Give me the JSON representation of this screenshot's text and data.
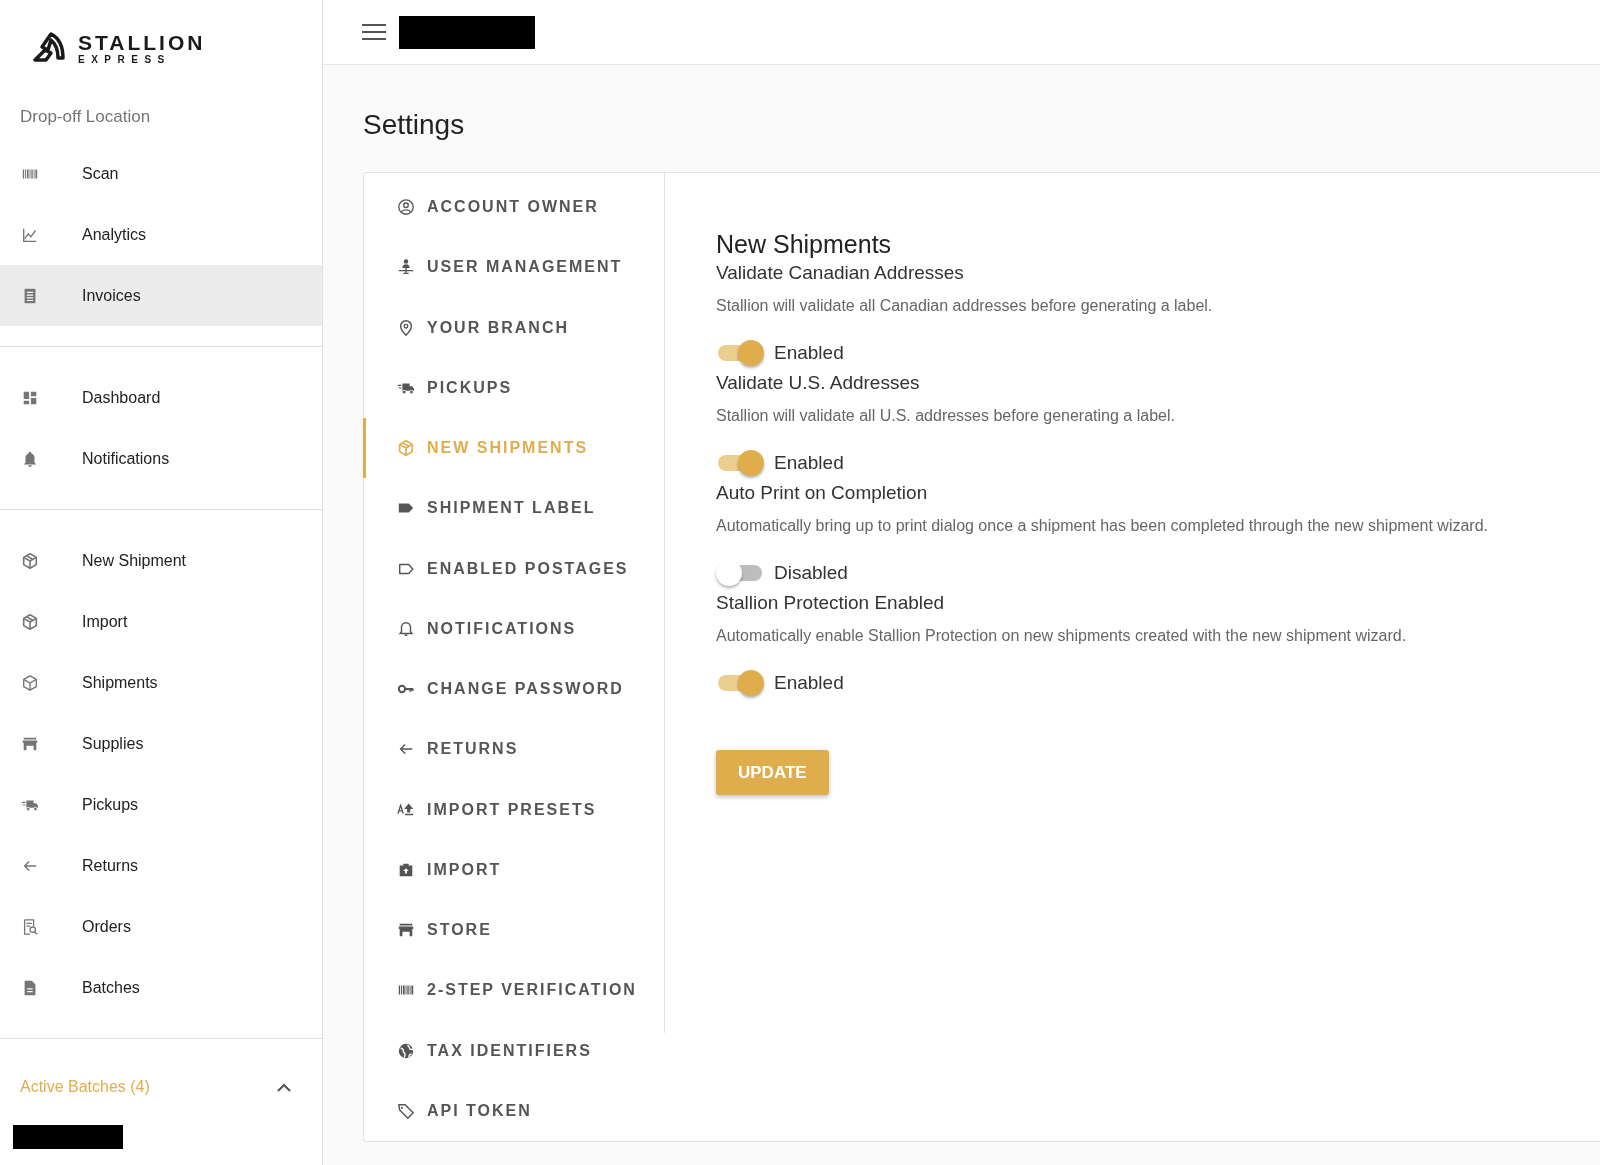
{
  "logo": {
    "name": "STALLION",
    "tagline": "EXPRESS"
  },
  "sidebar": {
    "location_label": "Drop-off Location",
    "sections": [
      {
        "items": [
          {
            "label": "Scan",
            "selected": false
          },
          {
            "label": "Analytics",
            "selected": false
          },
          {
            "label": "Invoices",
            "selected": true
          }
        ]
      },
      {
        "items": [
          {
            "label": "Dashboard",
            "selected": false
          },
          {
            "label": "Notifications",
            "selected": false
          }
        ]
      },
      {
        "items": [
          {
            "label": "New Shipment",
            "selected": false
          },
          {
            "label": "Import",
            "selected": false
          },
          {
            "label": "Shipments",
            "selected": false
          },
          {
            "label": "Supplies",
            "selected": false
          },
          {
            "label": "Pickups",
            "selected": false
          },
          {
            "label": "Returns",
            "selected": false
          },
          {
            "label": "Orders",
            "selected": false
          },
          {
            "label": "Batches",
            "selected": false
          }
        ]
      }
    ],
    "active_batches": {
      "label": "Active Batches (4)",
      "expanded": true
    }
  },
  "page_title": "Settings",
  "settings_nav": [
    {
      "label": "ACCOUNT OWNER",
      "selected": false
    },
    {
      "label": "USER MANAGEMENT",
      "selected": false
    },
    {
      "label": "YOUR BRANCH",
      "selected": false
    },
    {
      "label": "PICKUPS",
      "selected": false
    },
    {
      "label": "NEW SHIPMENTS",
      "selected": true
    },
    {
      "label": "SHIPMENT LABEL",
      "selected": false
    },
    {
      "label": "ENABLED POSTAGES",
      "selected": false
    },
    {
      "label": "NOTIFICATIONS",
      "selected": false
    },
    {
      "label": "CHANGE PASSWORD",
      "selected": false
    },
    {
      "label": "RETURNS",
      "selected": false
    },
    {
      "label": "IMPORT PRESETS",
      "selected": false
    },
    {
      "label": "IMPORT",
      "selected": false
    },
    {
      "label": "STORE",
      "selected": false
    },
    {
      "label": "2-STEP VERIFICATION",
      "selected": false
    },
    {
      "label": "TAX IDENTIFIERS",
      "selected": false
    },
    {
      "label": "API TOKEN",
      "selected": false
    }
  ],
  "panel": {
    "title": "New Shipments",
    "settings": [
      {
        "title": "Validate Canadian Addresses",
        "description": "Stallion will validate all Canadian addresses before generating a label.",
        "on": true,
        "state_label": "Enabled"
      },
      {
        "title": "Validate U.S. Addresses",
        "description": "Stallion will validate all U.S. addresses before generating a label.",
        "on": true,
        "state_label": "Enabled"
      },
      {
        "title": "Auto Print on Completion",
        "description": "Automatically bring up to print dialog once a shipment has been completed through the new shipment wizard.",
        "on": false,
        "state_label": "Disabled"
      },
      {
        "title": "Stallion Protection Enabled",
        "description": "Automatically enable Stallion Protection on new shipments created with the new shipment wizard.",
        "on": true,
        "state_label": "Enabled"
      }
    ],
    "button": "UPDATE"
  }
}
